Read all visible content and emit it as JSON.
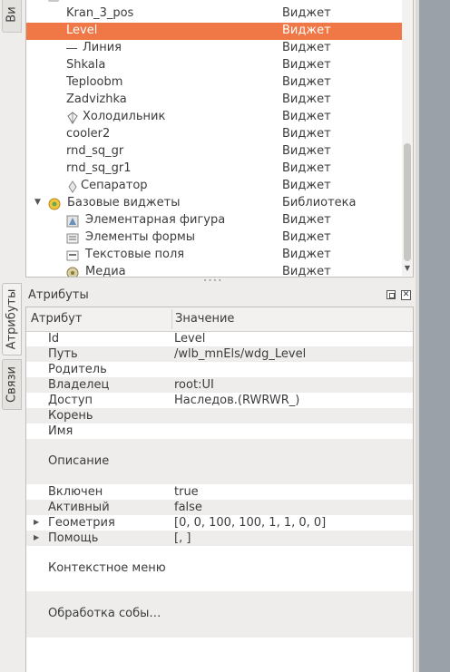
{
  "left_tabs": {
    "top_tab": "Ви",
    "attributes_tab": "Атрибуты",
    "links_tab": "Связи"
  },
  "tree": {
    "rows": [
      {
        "name": "",
        "type": ""
      },
      {
        "name": "Kran_3_pos",
        "type": "Виджет"
      },
      {
        "name": "Level",
        "type": "Виджет",
        "selected": true
      },
      {
        "name": "Линия",
        "type": "Виджет",
        "icon": "line-icon"
      },
      {
        "name": "Shkala",
        "type": "Виджет"
      },
      {
        "name": "Teploobm",
        "type": "Виджет"
      },
      {
        "name": "Zadvizhka",
        "type": "Виджет"
      },
      {
        "name": "Холодильник",
        "type": "Виджет",
        "icon": "cooler-icon"
      },
      {
        "name": "cooler2",
        "type": "Виджет"
      },
      {
        "name": "rnd_sq_gr",
        "type": "Виджет"
      },
      {
        "name": "rnd_sq_gr1",
        "type": "Виджет"
      },
      {
        "name": "Сепаратор",
        "type": "Виджет",
        "icon": "separator-icon"
      },
      {
        "name": "Базовые виджеты",
        "type": "Библиотека",
        "icon": "library-icon",
        "expanded": true
      },
      {
        "name": "Элементарная фигура",
        "type": "Виджет",
        "icon": "shape-icon"
      },
      {
        "name": "Элементы формы",
        "type": "Виджет",
        "icon": "form-icon"
      },
      {
        "name": "Текстовые поля",
        "type": "Виджет",
        "icon": "text-icon"
      },
      {
        "name": "Медиа",
        "type": "Виджет",
        "icon": "media-icon"
      }
    ]
  },
  "attributes_panel": {
    "title": "Атрибуты",
    "header_attribute": "Атрибут",
    "header_value": "Значение",
    "rows": [
      {
        "name": "Id",
        "value": "Level"
      },
      {
        "name": "Путь",
        "value": "/wlb_mnEls/wdg_Level"
      },
      {
        "name": "Родитель",
        "value": ""
      },
      {
        "name": "Владелец",
        "value": "root:UI"
      },
      {
        "name": "Доступ",
        "value": "Наследов.(RWRWR_)"
      },
      {
        "name": "Корень",
        "value": ""
      },
      {
        "name": "Имя",
        "value": ""
      },
      {
        "name": "Описание",
        "value": ""
      },
      {
        "name": "Включен",
        "value": "true"
      },
      {
        "name": "Активный",
        "value": "false"
      },
      {
        "name": "Геометрия",
        "value": "[0, 0, 100, 100, 1, 1, 0, 0]",
        "expandable": true
      },
      {
        "name": "Помощь",
        "value": "[, ]",
        "expandable": true
      },
      {
        "name": "Контекстное меню",
        "value": ""
      },
      {
        "name": "Обработка собы…",
        "value": ""
      }
    ]
  },
  "colors": {
    "selection": "#f07746",
    "alt_row": "#eeedec",
    "right_strip": "#9aa1a9"
  }
}
